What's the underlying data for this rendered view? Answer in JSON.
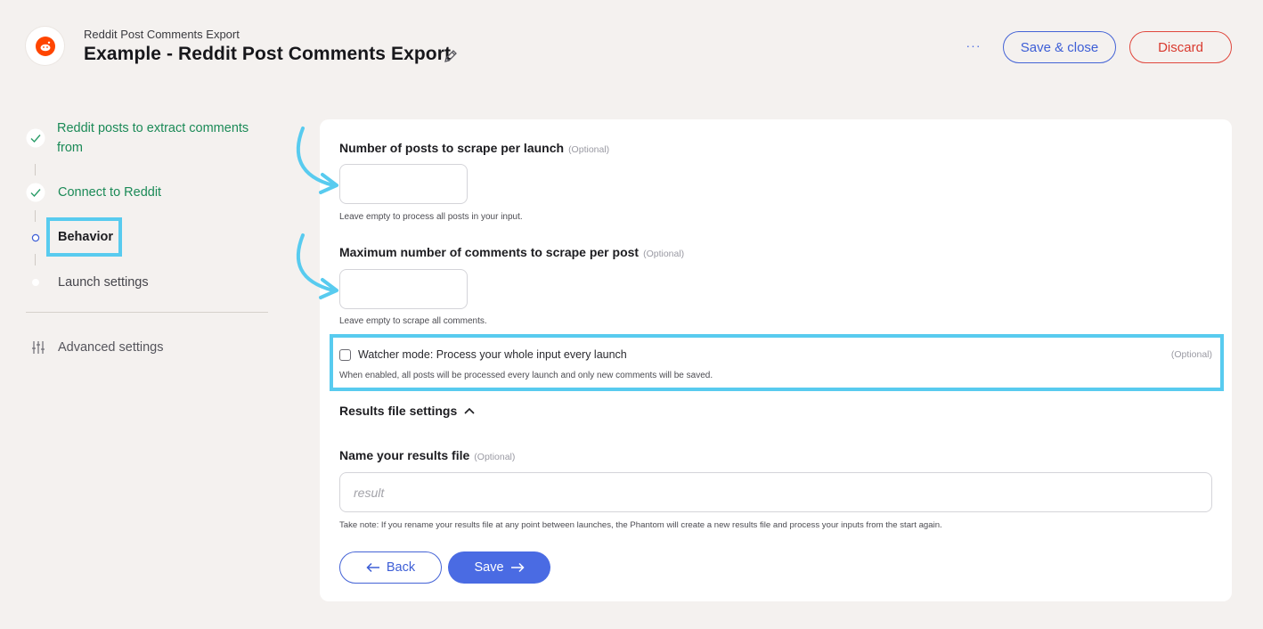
{
  "header": {
    "subtitle": "Reddit Post Comments Export",
    "title": "Example - Reddit Post Comments Export",
    "more_label": "···",
    "save_close_label": "Save & close",
    "discard_label": "Discard",
    "logo_icon": "reddit-logo",
    "edit_icon": "pencil-icon"
  },
  "sidebar": {
    "steps": [
      {
        "label": "Reddit posts to extract comments from",
        "state": "done"
      },
      {
        "label": "Connect to Reddit",
        "state": "done"
      },
      {
        "label": "Behavior",
        "state": "current"
      },
      {
        "label": "Launch settings",
        "state": "todo"
      }
    ],
    "advanced_label": "Advanced settings",
    "advanced_icon": "sliders-icon"
  },
  "form": {
    "posts_per_launch": {
      "label": "Number of posts to scrape per launch",
      "optional": "(Optional)",
      "value": "",
      "hint": "Leave empty to process all posts in your input."
    },
    "max_comments": {
      "label": "Maximum number of comments to scrape per post",
      "optional": "(Optional)",
      "value": "",
      "hint": "Leave empty to scrape all comments."
    },
    "watcher": {
      "label": "Watcher mode: Process your whole input every launch",
      "optional": "(Optional)",
      "checked": false,
      "hint": "When enabled, all posts will be processed every launch and only new comments will be saved."
    },
    "results_section_label": "Results file settings",
    "results_file": {
      "label": "Name your results file",
      "optional": "(Optional)",
      "placeholder": "result",
      "hint": "Take note: If you rename your results file at any point between launches, the Phantom will create a new results file and process your inputs from the start again."
    },
    "back_label": "Back",
    "save_label": "Save"
  },
  "colors": {
    "accent": "#4a6be3",
    "success": "#1b8a57",
    "danger": "#d9392e",
    "highlight": "#58cbef",
    "background": "#f4f1ef"
  }
}
